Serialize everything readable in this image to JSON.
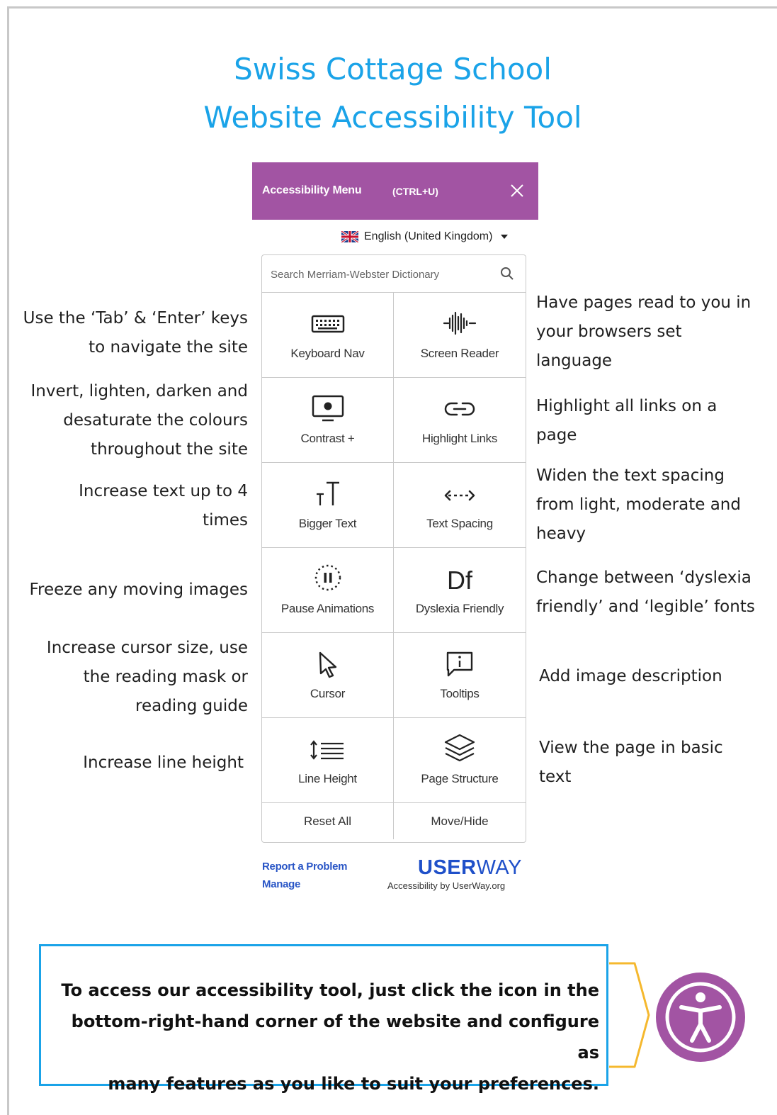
{
  "title": {
    "line1": "Swiss Cottage School",
    "line2": "Website Accessibility Tool"
  },
  "widget": {
    "header_title": "Accessibility Menu",
    "header_shortcut": "(CTRL+U)",
    "header_color": "#a254a3",
    "language": "English (United Kingdom)",
    "search_placeholder": "Search Merriam-Webster Dictionary",
    "tiles": [
      {
        "label": "Keyboard Nav",
        "icon": "keyboard-icon"
      },
      {
        "label": "Screen Reader",
        "icon": "sound-wave-icon"
      },
      {
        "label": "Contrast +",
        "icon": "monitor-icon"
      },
      {
        "label": "Highlight Links",
        "icon": "link-icon"
      },
      {
        "label": "Bigger Text",
        "icon": "text-size-icon"
      },
      {
        "label": "Text Spacing",
        "icon": "spacing-arrows-icon"
      },
      {
        "label": "Pause Animations",
        "icon": "pause-icon"
      },
      {
        "label": "Dyslexia Friendly",
        "icon": "df-font-icon"
      },
      {
        "label": "Cursor",
        "icon": "cursor-icon"
      },
      {
        "label": "Tooltips",
        "icon": "tooltip-icon"
      },
      {
        "label": "Line Height",
        "icon": "line-height-icon"
      },
      {
        "label": "Page Structure",
        "icon": "layers-icon"
      }
    ],
    "reset_label": "Reset All",
    "move_label": "Move/Hide",
    "report_link": "Report a Problem",
    "manage_link": "Manage",
    "logo_bold": "USER",
    "logo_light": "WAY",
    "logo_sub": "Accessibility by UserWay.org"
  },
  "descriptions": {
    "keyboard": [
      "Use the ‘Tab’ & ‘Enter’ keys",
      "to navigate the site"
    ],
    "contrast": [
      "Invert, lighten, darken and",
      "desaturate the colours",
      "throughout the site"
    ],
    "bigger_text": [
      "Increase text up to 4",
      "times"
    ],
    "pause": [
      "Freeze any moving images"
    ],
    "cursor": [
      "Increase cursor size, use",
      "the reading mask or",
      "reading guide"
    ],
    "line_height": [
      "Increase line height"
    ],
    "screen_reader": [
      "Have pages read to you in",
      "your browsers set",
      "language"
    ],
    "links": [
      "Highlight all links on a",
      "page"
    ],
    "spacing": [
      "Widen the text spacing",
      "from light, moderate and",
      "heavy"
    ],
    "dyslexia": [
      "Change between ‘dyslexia",
      "friendly’ and ‘legible’ fonts"
    ],
    "tooltips": [
      "Add image description"
    ],
    "structure": [
      "View the page in basic",
      "text"
    ]
  },
  "callout": {
    "lines": [
      "To access our accessibility tool, just click the icon in the",
      "bottom-right-hand corner of the website and configure as",
      "many features as you like to suit your preferences."
    ],
    "border_color": "#1aa3e8",
    "brace_color": "#f5b82e"
  }
}
